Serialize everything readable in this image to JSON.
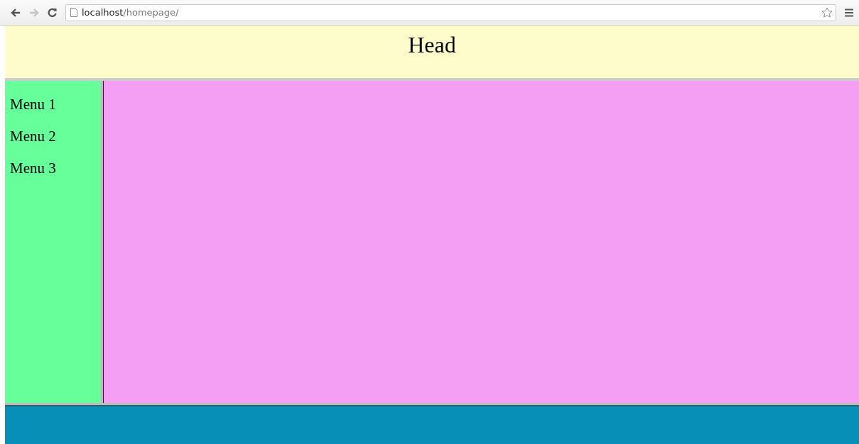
{
  "browser": {
    "back_disabled": false,
    "forward_disabled": true,
    "url_host": "localhost",
    "url_path": "/homepage/"
  },
  "header": {
    "title": "Head"
  },
  "sidebar": {
    "items": [
      {
        "label": "Menu 1"
      },
      {
        "label": "Menu 2"
      },
      {
        "label": "Menu 3"
      }
    ]
  }
}
